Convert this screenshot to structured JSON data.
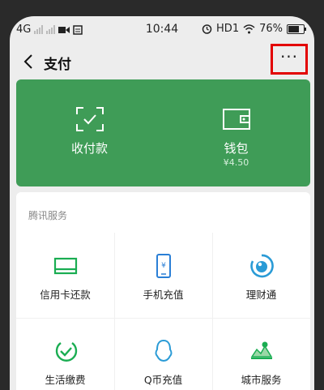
{
  "status_bar": {
    "network": "4G",
    "time": "10:44",
    "hd": "HD1",
    "battery": "76%"
  },
  "header": {
    "title": "支付",
    "more_label": "···"
  },
  "wallet_card": {
    "pay_code_label": "收付款",
    "wallet_label": "钱包",
    "wallet_balance": "¥4.50",
    "color": "#3f9c57"
  },
  "services": {
    "section_title": "腾讯服务",
    "items": [
      {
        "label": "信用卡还款",
        "icon": "credit-card-icon"
      },
      {
        "label": "手机充值",
        "icon": "phone-recharge-icon"
      },
      {
        "label": "理财通",
        "icon": "wealth-icon"
      },
      {
        "label": "生活缴费",
        "icon": "utilities-icon"
      },
      {
        "label": "Q币充值",
        "icon": "qq-coin-icon"
      },
      {
        "label": "城市服务",
        "icon": "city-services-icon"
      }
    ]
  }
}
